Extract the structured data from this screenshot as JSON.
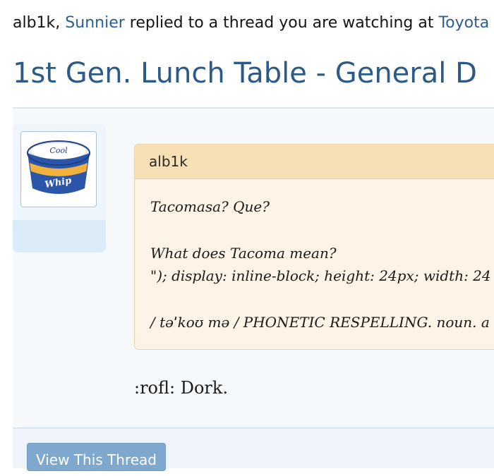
{
  "intro": {
    "recipient": "alb1k,",
    "poster": "Sunnier",
    "middle": "replied to a thread you are watching at",
    "forum": "Toyota T"
  },
  "thread": {
    "title": "1st Gen. Lunch Table - General D"
  },
  "post": {
    "avatar": {
      "label_top": "Cool",
      "label_bottom": "Whip"
    },
    "quote": {
      "author": "alb1k",
      "lines": [
        "Tacomasa? Que?",
        "What does Tacoma mean?",
        "\"); display: inline-block; height: 24px; width: 24",
        "/ təˈkoʊ mə / PHONETIC RESPELLING. noun. a"
      ]
    },
    "message": ":rofl: Dork."
  },
  "footer": {
    "button_label": "View This Thread"
  }
}
